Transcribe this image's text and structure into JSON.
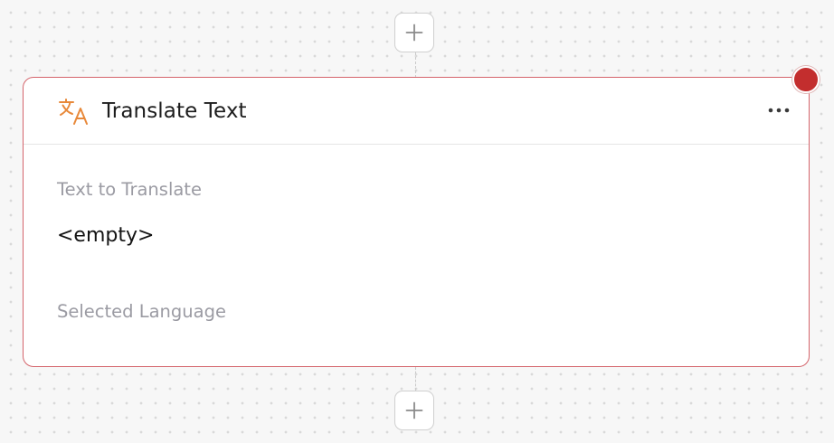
{
  "node": {
    "title": "Translate Text",
    "icon": "translate-icon",
    "menu_icon": "more-horizontal-icon",
    "fields": [
      {
        "label": "Text to Translate",
        "value": "<empty>"
      },
      {
        "label": "Selected Language",
        "value": ""
      }
    ]
  },
  "add_step": {
    "icon": "plus-icon"
  },
  "status": {
    "state": "error",
    "color": "#c32e2e"
  },
  "colors": {
    "accent_orange": "#e8893a",
    "node_border": "#d4646b",
    "label_gray": "#9b9ba3"
  }
}
